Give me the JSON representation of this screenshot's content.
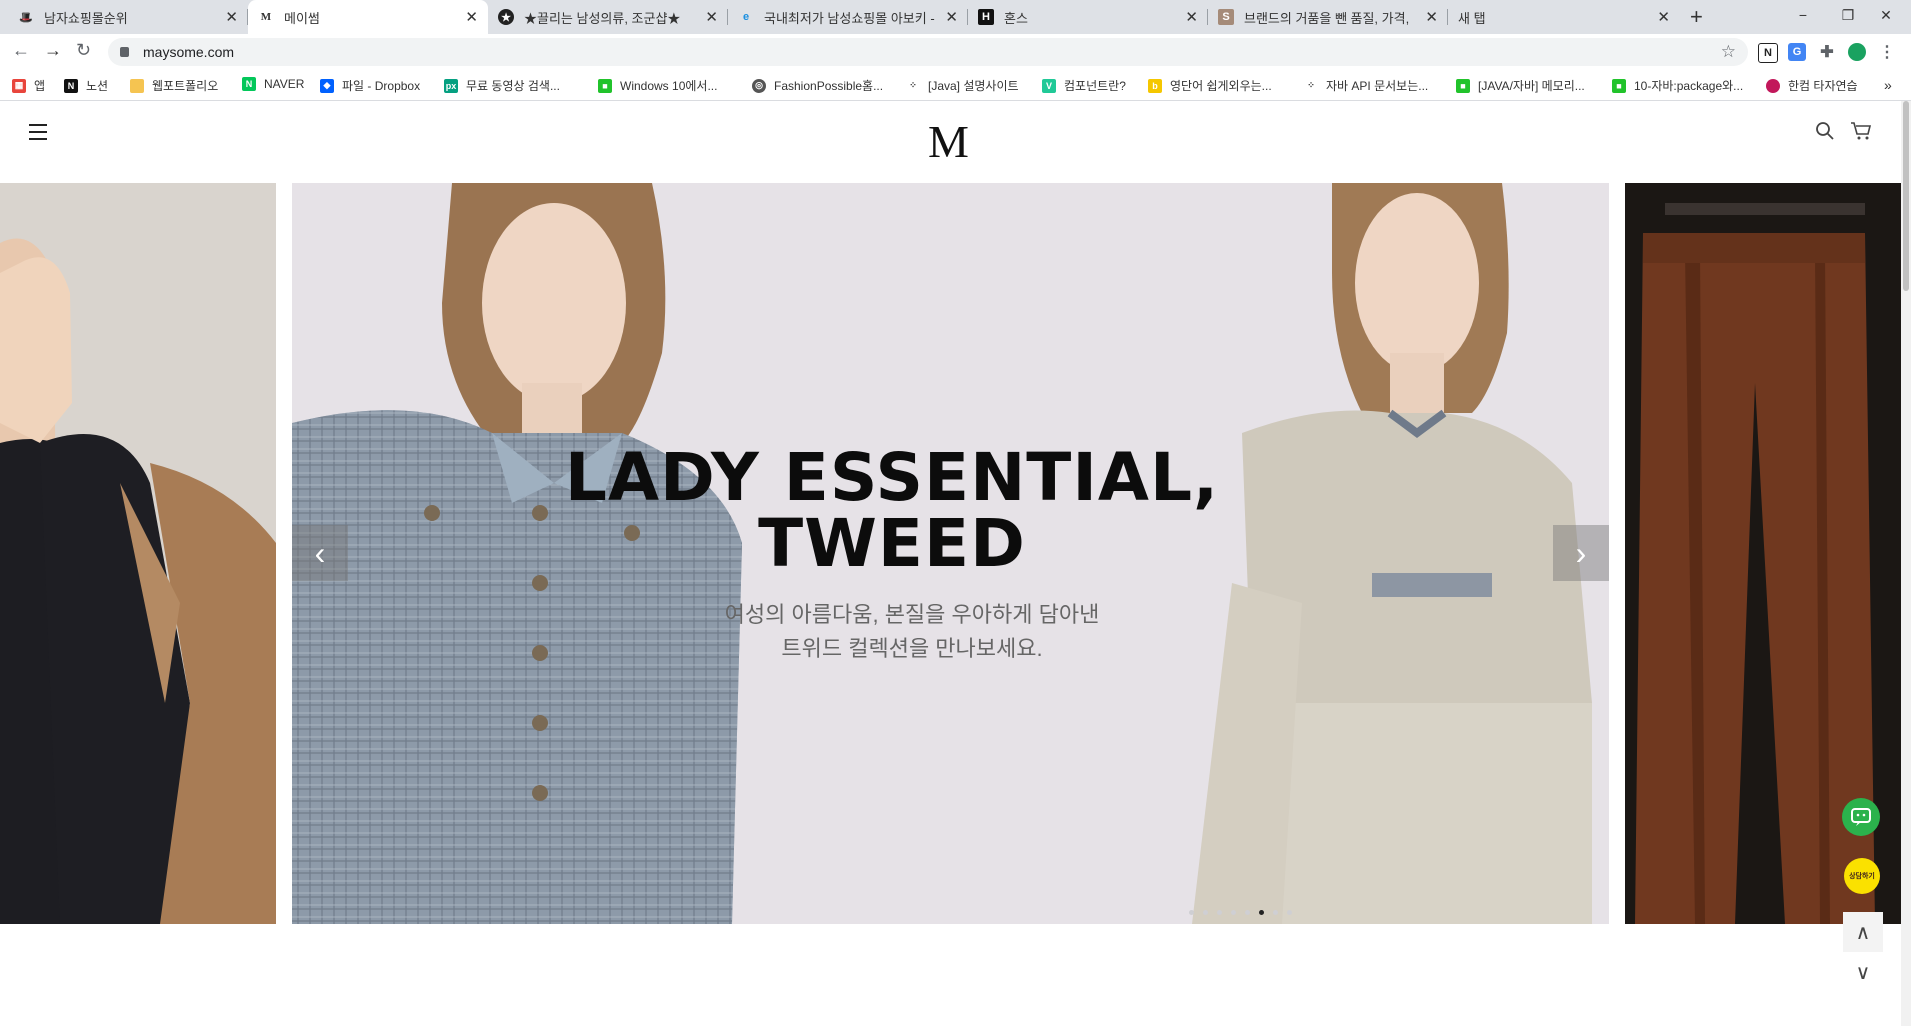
{
  "browser": {
    "tabs": [
      {
        "title": "남자쇼핑몰순위",
        "icon": "hat-icon",
        "active": false
      },
      {
        "title": "메이썸",
        "icon": "m-logo-icon",
        "active": true
      },
      {
        "title": "★끌리는 남성의류, 조군샵★",
        "icon": "star-icon",
        "active": false
      },
      {
        "title": "국내최저가 남성쇼핑몰 아보키 -",
        "icon": "edge-icon",
        "active": false
      },
      {
        "title": "혼스",
        "icon": "h-icon",
        "active": false
      },
      {
        "title": "브랜드의 거품을 뺀 품질, 가격,",
        "icon": "s-icon",
        "active": false
      },
      {
        "title": "새 탭",
        "icon": "",
        "active": false
      }
    ],
    "new_tab": "+",
    "window": {
      "minimize": "−",
      "restore": "❐",
      "close": "✕"
    },
    "url": "maysome.com",
    "bookmarks": [
      {
        "label": "앱",
        "icon": "apps-grid-icon",
        "color": "#e8453c"
      },
      {
        "label": "노션",
        "icon": "notion-icon",
        "color": "#111111"
      },
      {
        "label": "웹포트폴리오",
        "icon": "folder-icon",
        "color": "#f5c451"
      },
      {
        "label": "NAVER",
        "icon": "naver-icon",
        "color": "#03c75a"
      },
      {
        "label": "파일 - Dropbox",
        "icon": "dropbox-icon",
        "color": "#0061fe"
      },
      {
        "label": "무료 동영상 검색...",
        "icon": "pexels-icon",
        "color": "#05a081"
      },
      {
        "label": "Windows 10에서...",
        "icon": "line-icon",
        "color": "#21c32b"
      },
      {
        "label": "FashionPossible홈...",
        "icon": "globe-icon",
        "color": "#555555"
      },
      {
        "label": "[Java] 설명사이트",
        "icon": "tistory-icon",
        "color": "#333333"
      },
      {
        "label": "컴포넌트란?",
        "icon": "velog-icon",
        "color": "#20c997"
      },
      {
        "label": "영단어 쉽게외우는...",
        "icon": "bookmark-yellow-icon",
        "color": "#f5c700"
      },
      {
        "label": "자바 API 문서보는...",
        "icon": "tistory-icon",
        "color": "#333333"
      },
      {
        "label": "[JAVA/자바] 메모리...",
        "icon": "line-icon",
        "color": "#21c32b"
      },
      {
        "label": "10-자바:package와...",
        "icon": "line-icon",
        "color": "#21c32b"
      },
      {
        "label": "한컴 타자연습",
        "icon": "hancom-icon",
        "color": "#c2185b"
      }
    ],
    "bookmarks_more": "»"
  },
  "site": {
    "logo": "M",
    "hero": {
      "headline_line1": "LADY ESSENTIAL,",
      "headline_line2": "TWEED",
      "sub_line1": "여성의 아름다움, 본질을 우아하게 담아낸",
      "sub_line2": "트위드 컬렉션을 만나보세요.",
      "prev": "‹",
      "next": "›",
      "dots_count": 8,
      "active_dot": 5
    },
    "floating": {
      "kakao_label": "상담하기",
      "up": "∧",
      "down": "∨"
    }
  },
  "colors": {
    "chat_green": "#2bb24c",
    "kakao_yellow": "#fae100",
    "hero_bg": "#e6e2e7"
  }
}
